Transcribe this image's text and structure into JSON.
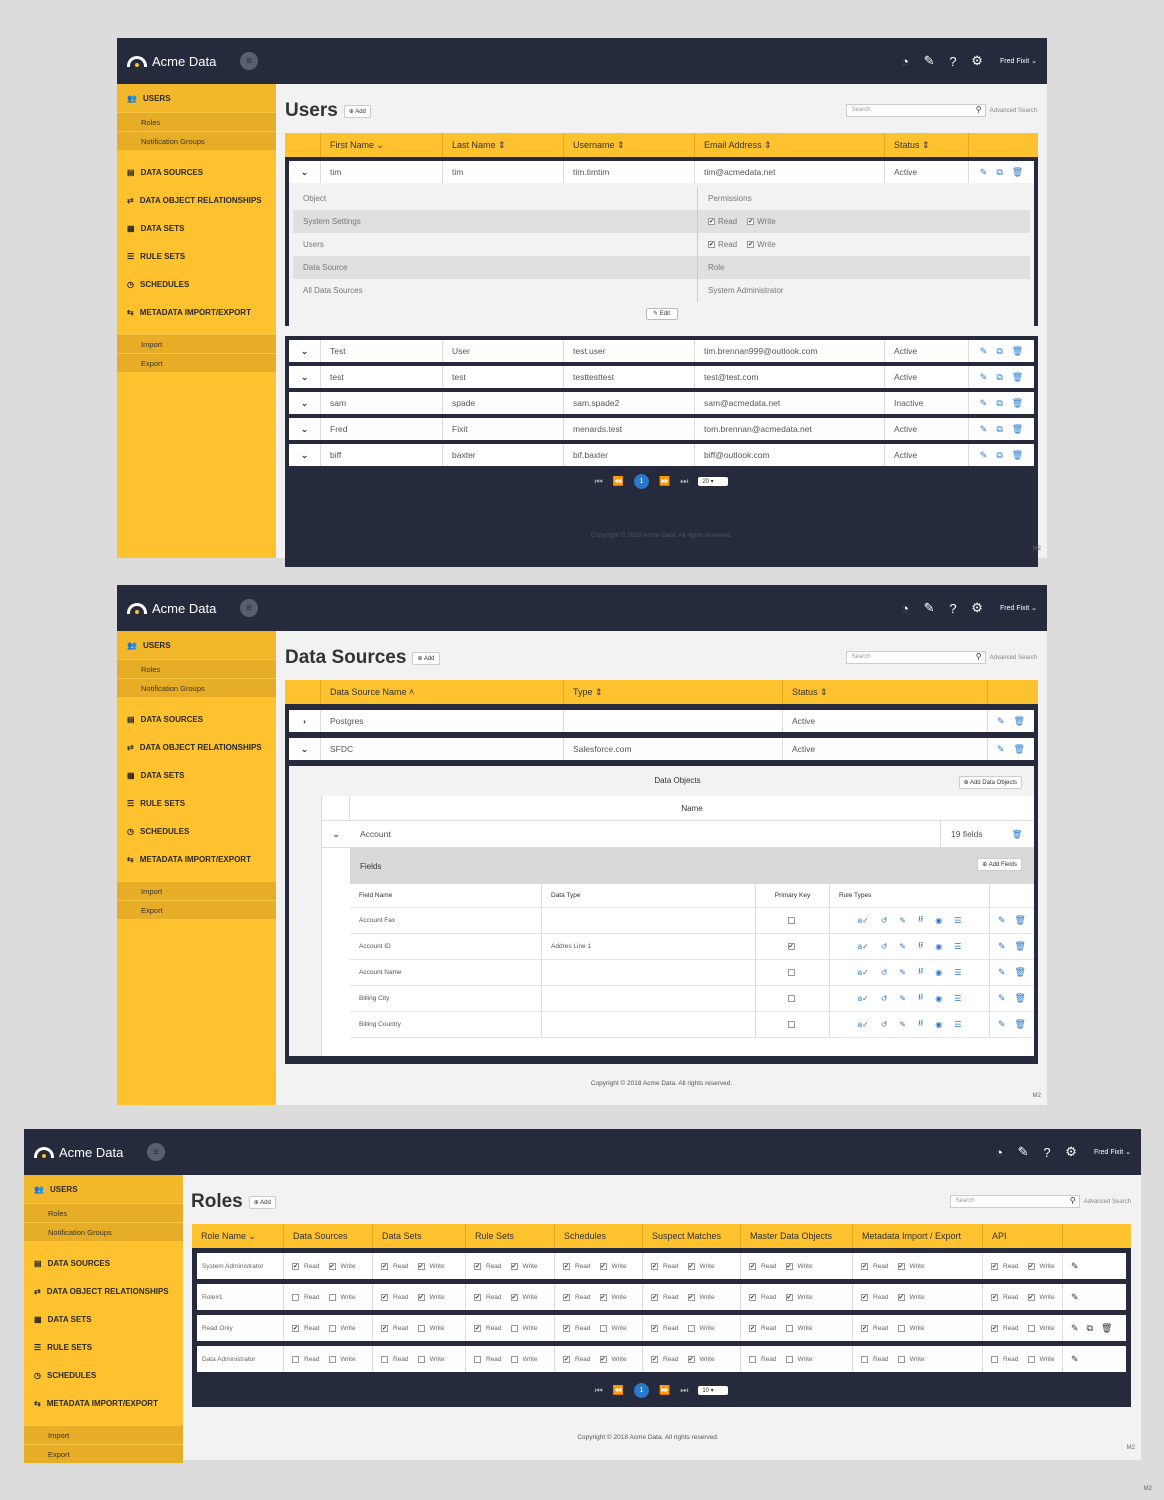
{
  "app": {
    "name": "Acme Data",
    "user": "Fred Fixit",
    "copyright": "Copyright ©  2018  Acme Data.   All rights reserved.",
    "version": "M2"
  },
  "sidebar": {
    "users": "USERS",
    "roles": "Roles",
    "notification_groups": "Notification Groups",
    "data_sources": "DATA SOURCES",
    "data_object_relationships": "DATA OBJECT RELATIONSHIPS",
    "data_sets": "DATA SETS",
    "rule_sets": "RULE SETS",
    "schedules": "SCHEDULES",
    "metadata": "METADATA IMPORT/EXPORT",
    "import": "Import",
    "export": "Export"
  },
  "common": {
    "add": "Add",
    "search_placeholder": "Search",
    "advanced_search": "Advanced Search",
    "read": "Read",
    "write": "Write",
    "edit": "Edit"
  },
  "users_page": {
    "title": "Users",
    "columns": [
      "First Name",
      "Last Name",
      "Username",
      "Email Address",
      "Status"
    ],
    "expanded": {
      "first": "tim",
      "last": "tim",
      "username": "tim.timtim",
      "email": "tim@acmedata.net",
      "status": "Active"
    },
    "perm_header": {
      "object": "Object",
      "permissions": "Permissions"
    },
    "perm_rows": [
      {
        "object": "System Settings"
      },
      {
        "object": "Users"
      }
    ],
    "ds_row": {
      "object": "Data Source",
      "value": "Role"
    },
    "all_row": {
      "object": "All Data Sources",
      "value": "System Administrator"
    },
    "rows": [
      {
        "first": "Test",
        "last": "User",
        "username": "test.user",
        "email": "tim.brennan999@outlook.com",
        "status": "Active"
      },
      {
        "first": "test",
        "last": "test",
        "username": "testtesttest",
        "email": "test@test.com",
        "status": "Active"
      },
      {
        "first": "sam",
        "last": "spade",
        "username": "sam.spade2",
        "email": "sam@acmedata.net",
        "status": "Inactive"
      },
      {
        "first": "Fred",
        "last": "Fixit",
        "username": "menards.test",
        "email": "tom.brennan@acmedata.net",
        "status": "Active"
      },
      {
        "first": "biff",
        "last": "baxter",
        "username": "bif.baxter",
        "email": "biff@outlook.com",
        "status": "Active"
      }
    ],
    "page": "1",
    "page_size": "20"
  },
  "ds_page": {
    "title": "Data Sources",
    "columns": [
      "Data Source Name",
      "Type",
      "Status"
    ],
    "rows": [
      {
        "name": "Postgres",
        "type": "",
        "status": "Active"
      },
      {
        "name": "SFDC",
        "type": "Salesforce.com",
        "status": "Active"
      }
    ],
    "data_objects": "Data Objects",
    "add_data_objects": "Add Data Objects",
    "name_col": "Name",
    "object": {
      "name": "Account",
      "fields": "19 fields"
    },
    "fields_label": "Fields",
    "add_fields": "Add Fields",
    "field_columns": [
      "Field Name",
      "Data Type",
      "Primary Key",
      "Rule Types"
    ],
    "fields": [
      {
        "name": "Account Fax",
        "type": "",
        "pk": ""
      },
      {
        "name": "Account ID",
        "type": "Addres Line 1",
        "pk": "✔"
      },
      {
        "name": "Account Name",
        "type": "",
        "pk": ""
      },
      {
        "name": "Billing City",
        "type": "",
        "pk": ""
      },
      {
        "name": "Billing Country",
        "type": "",
        "pk": ""
      }
    ]
  },
  "roles_page": {
    "title": "Roles",
    "columns": [
      "Role Name",
      "Data Sources",
      "Data Sets",
      "Rule Sets",
      "Schedules",
      "Suspect Matches",
      "Master Data Objects",
      "Metadata Import / Export",
      "API"
    ],
    "rows": [
      {
        "name": "System Administrator",
        "perms": [
          [
            1,
            1
          ],
          [
            1,
            1
          ],
          [
            1,
            1
          ],
          [
            1,
            1
          ],
          [
            1,
            1
          ],
          [
            1,
            1
          ],
          [
            1,
            1
          ],
          [
            1,
            1
          ]
        ]
      },
      {
        "name": "Role#1",
        "perms": [
          [
            0,
            0
          ],
          [
            1,
            1
          ],
          [
            1,
            1
          ],
          [
            1,
            1
          ],
          [
            1,
            1
          ],
          [
            1,
            1
          ],
          [
            1,
            1
          ],
          [
            1,
            1
          ]
        ]
      },
      {
        "name": "Read Only",
        "perms": [
          [
            1,
            0
          ],
          [
            1,
            0
          ],
          [
            1,
            0
          ],
          [
            1,
            0
          ],
          [
            1,
            0
          ],
          [
            1,
            0
          ],
          [
            1,
            0
          ],
          [
            1,
            0
          ]
        ]
      },
      {
        "name": "Data Administrator",
        "perms": [
          [
            0,
            0
          ],
          [
            0,
            0
          ],
          [
            0,
            0
          ],
          [
            1,
            1
          ],
          [
            1,
            1
          ],
          [
            0,
            0
          ],
          [
            0,
            0
          ],
          [
            0,
            0
          ]
        ]
      }
    ],
    "page": "1",
    "page_size": "10"
  }
}
